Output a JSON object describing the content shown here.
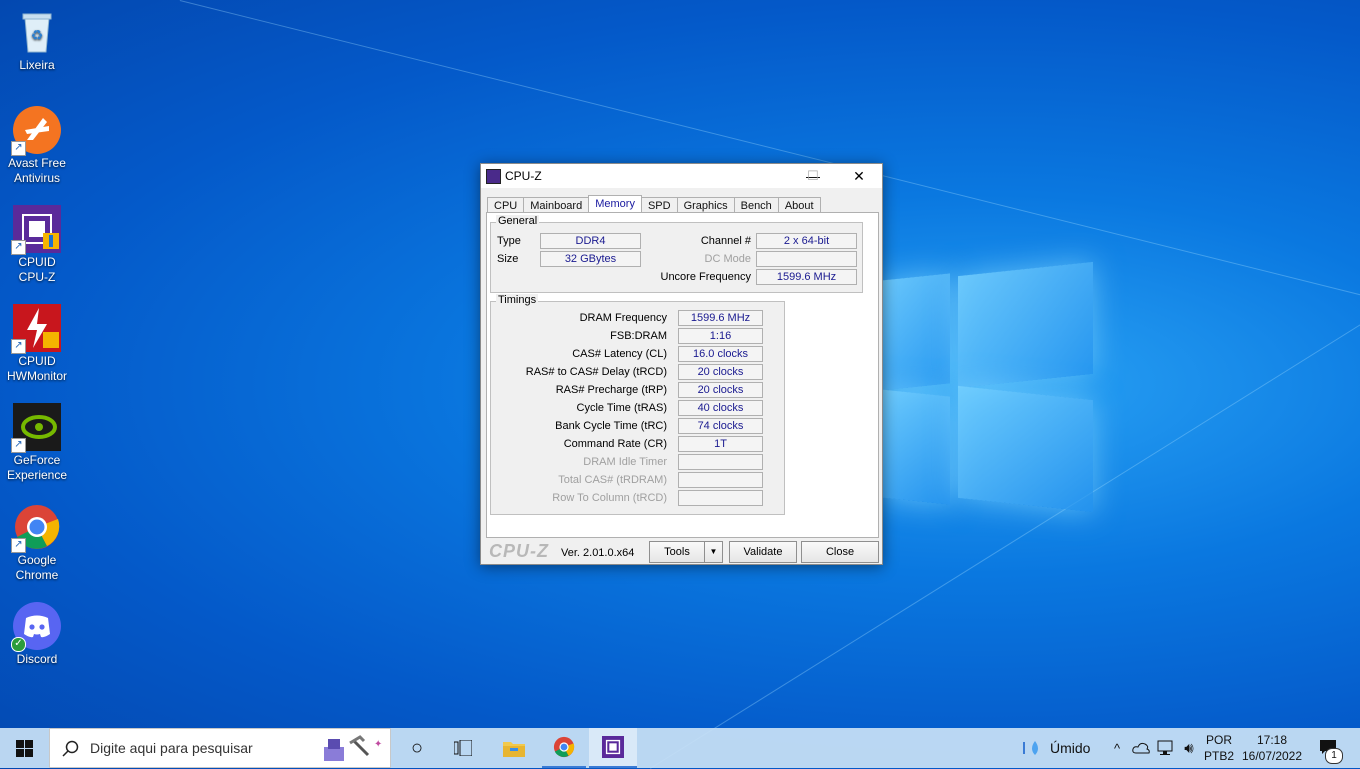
{
  "desktop": {
    "icons": [
      {
        "label1": "Lixeira",
        "label2": ""
      },
      {
        "label1": "Avast Free",
        "label2": "Antivirus"
      },
      {
        "label1": "CPUID",
        "label2": "CPU-Z"
      },
      {
        "label1": "CPUID",
        "label2": "HWMonitor"
      },
      {
        "label1": "GeForce",
        "label2": "Experience"
      },
      {
        "label1": "Google",
        "label2": "Chrome"
      },
      {
        "label1": "Discord",
        "label2": ""
      }
    ]
  },
  "window": {
    "title": "CPU-Z",
    "minimize_glyph": "—",
    "maximize_glyph": "☐",
    "close_glyph": "✕",
    "tabs": [
      {
        "label": "CPU"
      },
      {
        "label": "Mainboard"
      },
      {
        "label": "Memory"
      },
      {
        "label": "SPD"
      },
      {
        "label": "Graphics"
      },
      {
        "label": "Bench"
      },
      {
        "label": "About"
      }
    ],
    "active_tab": "Memory",
    "general": {
      "legend": "General",
      "type_label": "Type",
      "type_value": "DDR4",
      "size_label": "Size",
      "size_value": "32 GBytes",
      "channel_label": "Channel #",
      "channel_value": "2 x 64-bit",
      "dcmode_label": "DC Mode",
      "dcmode_value": "",
      "uncore_label": "Uncore Frequency",
      "uncore_value": "1599.6 MHz"
    },
    "timings": {
      "legend": "Timings",
      "rows": [
        {
          "label": "DRAM Frequency",
          "value": "1599.6 MHz"
        },
        {
          "label": "FSB:DRAM",
          "value": "1:16"
        },
        {
          "label": "CAS# Latency (CL)",
          "value": "16.0 clocks"
        },
        {
          "label": "RAS# to CAS# Delay (tRCD)",
          "value": "20 clocks"
        },
        {
          "label": "RAS# Precharge (tRP)",
          "value": "20 clocks"
        },
        {
          "label": "Cycle Time (tRAS)",
          "value": "40 clocks"
        },
        {
          "label": "Bank Cycle Time (tRC)",
          "value": "74 clocks"
        },
        {
          "label": "Command Rate (CR)",
          "value": "1T"
        },
        {
          "label": "DRAM Idle Timer",
          "value": ""
        },
        {
          "label": "Total CAS# (tRDRAM)",
          "value": ""
        },
        {
          "label": "Row To Column (tRCD)",
          "value": ""
        }
      ]
    },
    "footer": {
      "brand": "CPU-Z",
      "version": "Ver. 2.01.0.x64",
      "tools_label": "Tools",
      "tools_arrow": "▼",
      "validate_label": "Validate",
      "close_label": "Close"
    }
  },
  "taskbar": {
    "search_placeholder": "Digite aqui para pesquisar",
    "weather": "Úmido",
    "lang1": "POR",
    "lang2": "PTB2",
    "time": "17:18",
    "date": "16/07/2022",
    "notification_count": "1"
  }
}
